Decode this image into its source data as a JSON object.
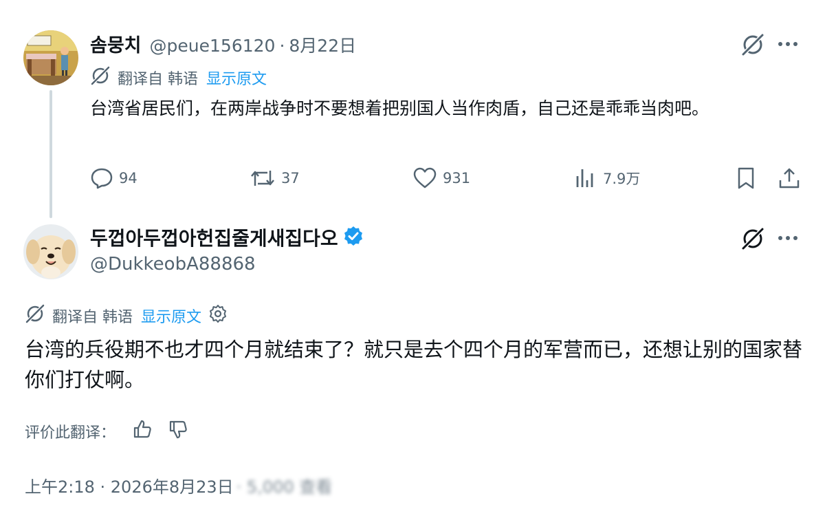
{
  "parent_tweet": {
    "display_name": "솜뭉치",
    "handle": "@peue156120",
    "separator": "·",
    "date": "8月22日",
    "translated_from": "翻译自 韩语",
    "show_original": "显示原文",
    "text": "台湾省居民们，在两岸战争时不要想着把别国人当作肉盾，自己还是乖乖当肉吧。",
    "stats": {
      "replies": "94",
      "retweets": "37",
      "likes": "931",
      "views": "7.9万"
    }
  },
  "focal_tweet": {
    "display_name": "두껍아두껍아헌집줄게새집다오",
    "handle": "@DukkeobA88868",
    "translated_from": "翻译自 韩语",
    "show_original": "显示原文",
    "text": "台湾的兵役期不也才四个月就结束了？就只是去个四个月的军营而已，还想让别的国家替你们打仗啊。",
    "rate_translation": "评价此翻译：",
    "timestamp": "上午2:18 · 2026年8月23日",
    "views_obscured": "· 5,000 查看"
  },
  "colors": {
    "text_primary": "#0f1419",
    "text_secondary": "#536471",
    "link": "#1d9bf0",
    "verified": "#1d9bf0",
    "thread_line": "#cfd9de"
  },
  "icons": [
    "grok-icon",
    "more-icon",
    "translate-icon",
    "reply-icon",
    "retweet-icon",
    "like-icon",
    "views-icon",
    "bookmark-icon",
    "share-icon",
    "verified-badge-icon",
    "settings-gear-icon",
    "thumbs-up-icon",
    "thumbs-down-icon"
  ]
}
